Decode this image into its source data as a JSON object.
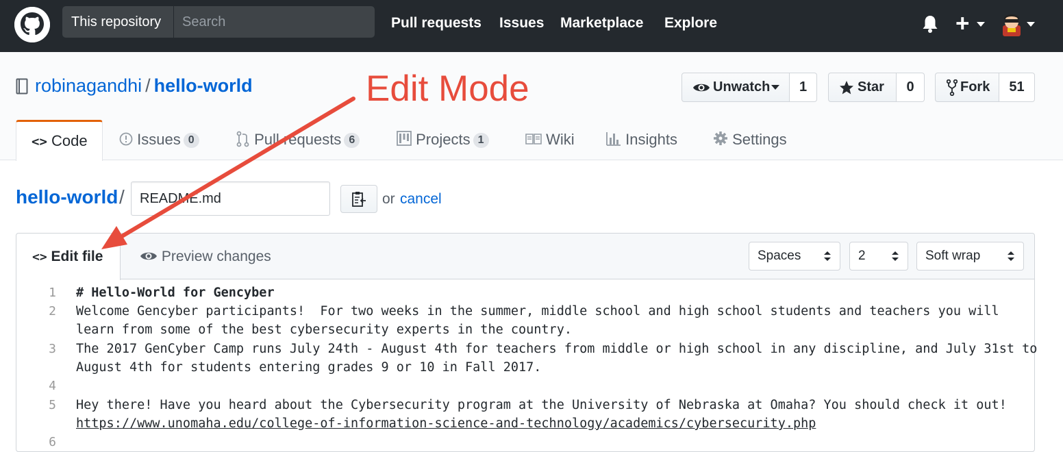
{
  "topbar": {
    "scope_label": "This repository",
    "search_placeholder": "Search",
    "nav": [
      "Pull requests",
      "Issues",
      "Marketplace",
      "Explore"
    ]
  },
  "repo": {
    "owner": "robinagandhi",
    "separator": "/",
    "name": "hello-world",
    "watch_label": "Unwatch",
    "watch_count": "1",
    "star_label": "Star",
    "star_count": "0",
    "fork_label": "Fork",
    "fork_count": "51"
  },
  "tabs": {
    "code": "Code",
    "issues": "Issues",
    "issues_count": "0",
    "pulls": "Pull requests",
    "pulls_count": "6",
    "projects": "Projects",
    "projects_count": "1",
    "wiki": "Wiki",
    "insights": "Insights",
    "settings": "Settings"
  },
  "breadcrumb": {
    "repo": "hello-world",
    "separator": "/",
    "filename": "README.md",
    "or": "or",
    "cancel": "cancel"
  },
  "editor": {
    "edit_tab": "Edit file",
    "preview_tab": "Preview changes",
    "indent_mode": "Spaces",
    "indent_size": "2",
    "wrap_mode": "Soft wrap",
    "lines": [
      {
        "num": "1",
        "text": "# Hello-World for Gencyber"
      },
      {
        "num": "2",
        "text": "Welcome Gencyber participants!  For two weeks in the summer, middle school and high school students and teachers you will"
      },
      {
        "num": "",
        "text": "learn from some of the best cybersecurity experts in the country."
      },
      {
        "num": "3",
        "text": "The 2017 GenCyber Camp runs July 24th - August 4th for teachers from middle or high school in any discipline, and July 31st to"
      },
      {
        "num": "",
        "text": "August 4th for students entering grades 9 or 10 in Fall 2017."
      },
      {
        "num": "4",
        "text": ""
      },
      {
        "num": "5",
        "text": "Hey there! Have you heard about the Cybersecurity program at the University of Nebraska at Omaha? You should check it out!"
      },
      {
        "num": "",
        "text": "https://www.unomaha.edu/college-of-information-science-and-technology/academics/cybersecurity.php"
      },
      {
        "num": "6",
        "text": ""
      }
    ]
  },
  "annotation": {
    "text": "Edit Mode",
    "color": "#e74c3c"
  },
  "colors": {
    "header_bg": "#24292e",
    "link": "#0366d6",
    "active_tab_border": "#e36209"
  }
}
